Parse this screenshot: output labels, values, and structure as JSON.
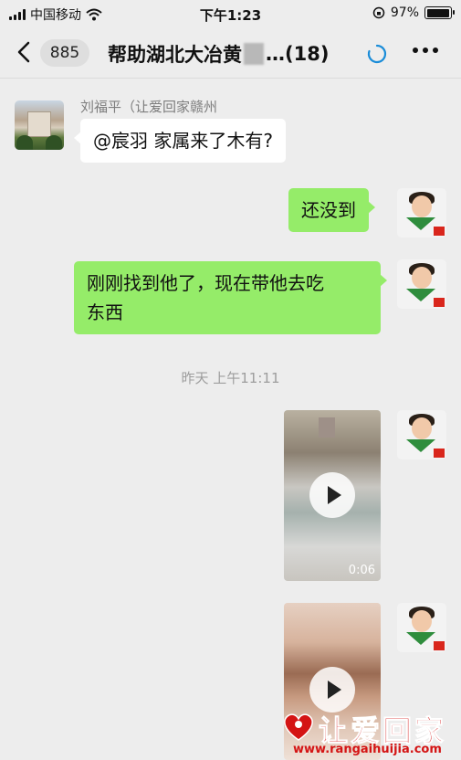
{
  "status_bar": {
    "carrier": "中国移动",
    "time": "下午1:23",
    "battery": "97%",
    "battery_level": 0.97
  },
  "header": {
    "unread_count": "885",
    "title_prefix": "帮助湖北大冶黄",
    "title_suffix": "…(18)"
  },
  "messages": [
    {
      "sender": "刘福平（让爱回家赣州",
      "text": "@宸羽 家属来了木有?"
    },
    {
      "text": "还没到"
    },
    {
      "text_line1": "刚刚找到他了，现在带他去吃",
      "text_line2": "东西"
    }
  ],
  "timestamp": "昨天 上午11:11",
  "videos": [
    {
      "duration": "0:06"
    },
    {
      "duration": ""
    }
  ],
  "watermark": {
    "text": "让爱回家",
    "url": "www.rangaihuijia.com"
  },
  "colors": {
    "background": "#ededed",
    "my_bubble": "#95ec69",
    "their_bubble": "#ffffff",
    "watermark": "#d41414"
  },
  "icons": [
    "back-icon",
    "loading-icon",
    "more-icon",
    "play-icon",
    "wifi-icon",
    "signal-icon",
    "battery-icon",
    "orientation-lock-icon"
  ]
}
